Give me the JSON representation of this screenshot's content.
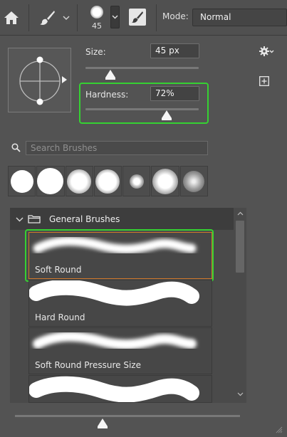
{
  "toolbar": {
    "home_icon": "home-icon",
    "brush_tool_icon": "paintbrush-icon",
    "brush_size_thumb": "45",
    "toggle_icon": "brush-settings-icon",
    "mode_label": "Mode:",
    "mode_value": "Normal"
  },
  "brush_picker": {
    "size_label": "Size:",
    "size_value": "45 px",
    "size_level": 0.12,
    "hardness_label": "Hardness:",
    "hardness_value": "72%",
    "hardness_level": 0.72,
    "settings_icon": "gear-icon",
    "new_preset_icon": "new-preset-icon",
    "search_placeholder": "Search Brushes",
    "recent_brushes": [
      "hard-round",
      "hard-round-large",
      "soft-round",
      "soft-round",
      "small-soft",
      "soft-round",
      "soft-round-faint"
    ],
    "group": {
      "name": "General Brushes",
      "items": [
        {
          "label": "Soft Round",
          "selected": true
        },
        {
          "label": "Hard Round",
          "selected": false
        },
        {
          "label": "Soft Round Pressure Size",
          "selected": false
        },
        {
          "label": "",
          "selected": false
        }
      ]
    }
  },
  "highlight_color": "#35d132",
  "selection_color": "#d0782a"
}
